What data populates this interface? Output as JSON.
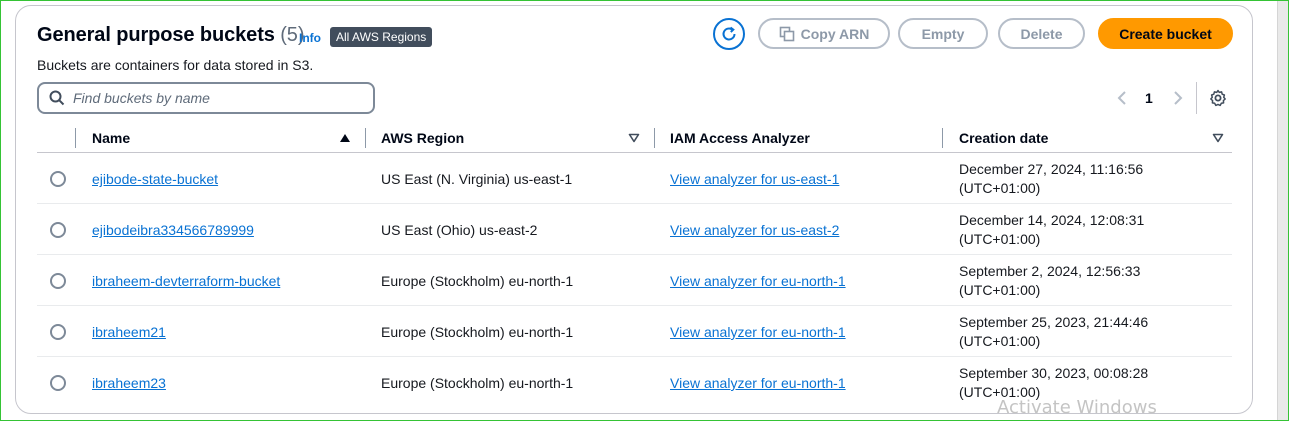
{
  "header": {
    "title": "General purpose buckets",
    "count": "(5)",
    "info_label": "Info",
    "region_badge": "All AWS Regions",
    "description": "Buckets are containers for data stored in S3."
  },
  "toolbar": {
    "refresh_icon": "refresh-icon",
    "copy_arn_label": "Copy ARN",
    "empty_label": "Empty",
    "delete_label": "Delete",
    "create_label": "Create bucket"
  },
  "search": {
    "placeholder": "Find buckets by name",
    "value": ""
  },
  "pagination": {
    "current_page": "1"
  },
  "table": {
    "columns": [
      "Name",
      "AWS Region",
      "IAM Access Analyzer",
      "Creation date"
    ],
    "rows": [
      {
        "name": "ejibode-state-bucket",
        "region": "US East (N. Virginia) us-east-1",
        "iam": "View analyzer for us-east-1",
        "date_line1": "December 27, 2024, 11:16:56",
        "date_line2": "(UTC+01:00)"
      },
      {
        "name": "ejibodeibra334566789999",
        "region": "US East (Ohio) us-east-2",
        "iam": "View analyzer for us-east-2",
        "date_line1": "December 14, 2024, 12:08:31",
        "date_line2": "(UTC+01:00)"
      },
      {
        "name": "ibraheem-devterraform-bucket",
        "region": "Europe (Stockholm) eu-north-1",
        "iam": "View analyzer for eu-north-1",
        "date_line1": "September 2, 2024, 12:56:33",
        "date_line2": "(UTC+01:00)"
      },
      {
        "name": "ibraheem21",
        "region": "Europe (Stockholm) eu-north-1",
        "iam": "View analyzer for eu-north-1",
        "date_line1": "September 25, 2023, 21:44:46",
        "date_line2": "(UTC+01:00)"
      },
      {
        "name": "ibraheem23",
        "region": "Europe (Stockholm) eu-north-1",
        "iam": "View analyzer for eu-north-1",
        "date_line1": "September 30, 2023, 00:08:28",
        "date_line2": "(UTC+01:00)"
      }
    ]
  },
  "watermark": "Activate Windows",
  "colors": {
    "link": "#0972d3",
    "primary_button": "#ff9900",
    "badge": "#414d5c",
    "disabled": "#8d99a8"
  }
}
